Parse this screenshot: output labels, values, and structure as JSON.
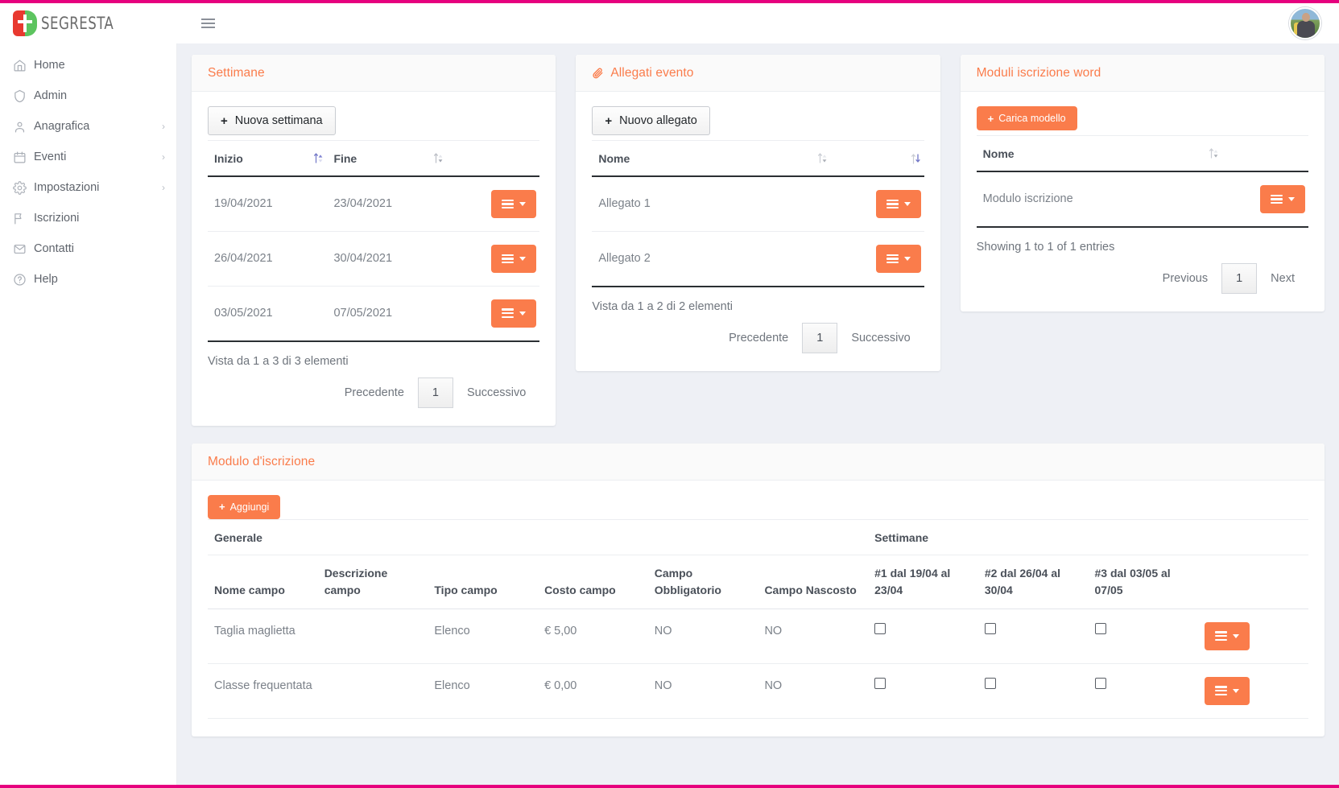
{
  "brand": {
    "name": "SEGRESTA",
    "logo_icon": "segresta-logo"
  },
  "topbar": {
    "menu_toggle_icon": "hamburger-icon",
    "avatar_icon": "user-avatar"
  },
  "sidebar": {
    "items": [
      {
        "label": "Home",
        "icon": "home-icon",
        "has_caret": false
      },
      {
        "label": "Admin",
        "icon": "shield-icon",
        "has_caret": false
      },
      {
        "label": "Anagrafica",
        "icon": "user-icon",
        "has_caret": true,
        "caret": "›"
      },
      {
        "label": "Eventi",
        "icon": "calendar-icon",
        "has_caret": true,
        "caret": "›"
      },
      {
        "label": "Impostazioni",
        "icon": "gear-icon",
        "has_caret": true,
        "caret": "›"
      },
      {
        "label": "Iscrizioni",
        "icon": "flag-icon",
        "has_caret": false
      },
      {
        "label": "Contatti",
        "icon": "mail-icon",
        "has_caret": false
      },
      {
        "label": "Help",
        "icon": "help-circle-icon",
        "has_caret": false
      }
    ]
  },
  "colors": {
    "accent_orange": "#fa7c4b",
    "page_border_magenta": "#e6007e",
    "background": "#eef0f5"
  },
  "cards": {
    "settimane": {
      "title": "Settimane",
      "add_button": "Nuova settimana",
      "columns": [
        "Inizio",
        "Fine"
      ],
      "rows": [
        {
          "inizio": "19/04/2021",
          "fine": "23/04/2021"
        },
        {
          "inizio": "26/04/2021",
          "fine": "30/04/2021"
        },
        {
          "inizio": "03/05/2021",
          "fine": "07/05/2021"
        }
      ],
      "info": "Vista da 1 a 3 di 3 elementi",
      "pager": {
        "previous": "Precedente",
        "current": "1",
        "next": "Successivo"
      }
    },
    "allegati": {
      "title": "Allegati evento",
      "title_icon": "paperclip-icon",
      "add_button": "Nuovo allegato",
      "columns": [
        "Nome"
      ],
      "rows": [
        {
          "nome": "Allegato 1"
        },
        {
          "nome": "Allegato 2"
        }
      ],
      "info": "Vista da 1 a 2 di 2 elementi",
      "pager": {
        "previous": "Precedente",
        "current": "1",
        "next": "Successivo"
      }
    },
    "moduli": {
      "title": "Moduli iscrizione word",
      "add_button": "Carica modello",
      "columns": [
        "Nome"
      ],
      "rows": [
        {
          "nome": "Modulo iscrizione"
        }
      ],
      "info": "Showing 1 to 1 of 1 entries",
      "pager": {
        "previous": "Previous",
        "current": "1",
        "next": "Next"
      }
    }
  },
  "modulo_iscrizione": {
    "title": "Modulo d'iscrizione",
    "add_button": "Aggiungi",
    "group_headers": {
      "generale": "Generale",
      "settimane": "Settimane"
    },
    "columns": {
      "nome_campo": "Nome campo",
      "descrizione_campo": "Descrizione campo",
      "tipo_campo": "Tipo campo",
      "costo_campo": "Costo campo",
      "campo_obbligatorio": "Campo Obbligatorio",
      "campo_nascosto": "Campo Nascosto"
    },
    "week_columns": [
      {
        "label": "#1 dal 19/04 al 23/04"
      },
      {
        "label": "#2 dal 26/04 al 30/04"
      },
      {
        "label": "#3 dal 03/05 al 07/05"
      }
    ],
    "rows": [
      {
        "nome_campo": "Taglia maglietta",
        "descrizione_campo": "",
        "tipo_campo": "Elenco",
        "costo_campo": "€ 5,00",
        "campo_obbligatorio": "NO",
        "campo_nascosto": "NO",
        "weeks": [
          false,
          false,
          false
        ]
      },
      {
        "nome_campo": "Classe frequentata",
        "descrizione_campo": "",
        "tipo_campo": "Elenco",
        "costo_campo": "€ 0,00",
        "campo_obbligatorio": "NO",
        "campo_nascosto": "NO",
        "weeks": [
          false,
          false,
          false
        ]
      }
    ]
  }
}
